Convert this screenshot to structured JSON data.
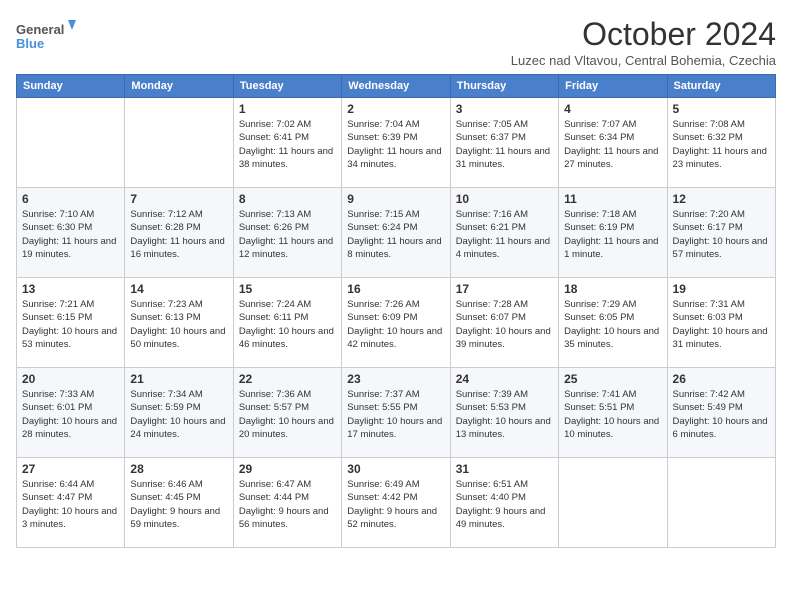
{
  "logo": {
    "text_general": "General",
    "text_blue": "Blue"
  },
  "header": {
    "month_year": "October 2024",
    "location": "Luzec nad Vltavou, Central Bohemia, Czechia"
  },
  "weekdays": [
    "Sunday",
    "Monday",
    "Tuesday",
    "Wednesday",
    "Thursday",
    "Friday",
    "Saturday"
  ],
  "weeks": [
    [
      {
        "day": "",
        "sunrise": "",
        "sunset": "",
        "daylight": ""
      },
      {
        "day": "",
        "sunrise": "",
        "sunset": "",
        "daylight": ""
      },
      {
        "day": "1",
        "sunrise": "Sunrise: 7:02 AM",
        "sunset": "Sunset: 6:41 PM",
        "daylight": "Daylight: 11 hours and 38 minutes."
      },
      {
        "day": "2",
        "sunrise": "Sunrise: 7:04 AM",
        "sunset": "Sunset: 6:39 PM",
        "daylight": "Daylight: 11 hours and 34 minutes."
      },
      {
        "day": "3",
        "sunrise": "Sunrise: 7:05 AM",
        "sunset": "Sunset: 6:37 PM",
        "daylight": "Daylight: 11 hours and 31 minutes."
      },
      {
        "day": "4",
        "sunrise": "Sunrise: 7:07 AM",
        "sunset": "Sunset: 6:34 PM",
        "daylight": "Daylight: 11 hours and 27 minutes."
      },
      {
        "day": "5",
        "sunrise": "Sunrise: 7:08 AM",
        "sunset": "Sunset: 6:32 PM",
        "daylight": "Daylight: 11 hours and 23 minutes."
      }
    ],
    [
      {
        "day": "6",
        "sunrise": "Sunrise: 7:10 AM",
        "sunset": "Sunset: 6:30 PM",
        "daylight": "Daylight: 11 hours and 19 minutes."
      },
      {
        "day": "7",
        "sunrise": "Sunrise: 7:12 AM",
        "sunset": "Sunset: 6:28 PM",
        "daylight": "Daylight: 11 hours and 16 minutes."
      },
      {
        "day": "8",
        "sunrise": "Sunrise: 7:13 AM",
        "sunset": "Sunset: 6:26 PM",
        "daylight": "Daylight: 11 hours and 12 minutes."
      },
      {
        "day": "9",
        "sunrise": "Sunrise: 7:15 AM",
        "sunset": "Sunset: 6:24 PM",
        "daylight": "Daylight: 11 hours and 8 minutes."
      },
      {
        "day": "10",
        "sunrise": "Sunrise: 7:16 AM",
        "sunset": "Sunset: 6:21 PM",
        "daylight": "Daylight: 11 hours and 4 minutes."
      },
      {
        "day": "11",
        "sunrise": "Sunrise: 7:18 AM",
        "sunset": "Sunset: 6:19 PM",
        "daylight": "Daylight: 11 hours and 1 minute."
      },
      {
        "day": "12",
        "sunrise": "Sunrise: 7:20 AM",
        "sunset": "Sunset: 6:17 PM",
        "daylight": "Daylight: 10 hours and 57 minutes."
      }
    ],
    [
      {
        "day": "13",
        "sunrise": "Sunrise: 7:21 AM",
        "sunset": "Sunset: 6:15 PM",
        "daylight": "Daylight: 10 hours and 53 minutes."
      },
      {
        "day": "14",
        "sunrise": "Sunrise: 7:23 AM",
        "sunset": "Sunset: 6:13 PM",
        "daylight": "Daylight: 10 hours and 50 minutes."
      },
      {
        "day": "15",
        "sunrise": "Sunrise: 7:24 AM",
        "sunset": "Sunset: 6:11 PM",
        "daylight": "Daylight: 10 hours and 46 minutes."
      },
      {
        "day": "16",
        "sunrise": "Sunrise: 7:26 AM",
        "sunset": "Sunset: 6:09 PM",
        "daylight": "Daylight: 10 hours and 42 minutes."
      },
      {
        "day": "17",
        "sunrise": "Sunrise: 7:28 AM",
        "sunset": "Sunset: 6:07 PM",
        "daylight": "Daylight: 10 hours and 39 minutes."
      },
      {
        "day": "18",
        "sunrise": "Sunrise: 7:29 AM",
        "sunset": "Sunset: 6:05 PM",
        "daylight": "Daylight: 10 hours and 35 minutes."
      },
      {
        "day": "19",
        "sunrise": "Sunrise: 7:31 AM",
        "sunset": "Sunset: 6:03 PM",
        "daylight": "Daylight: 10 hours and 31 minutes."
      }
    ],
    [
      {
        "day": "20",
        "sunrise": "Sunrise: 7:33 AM",
        "sunset": "Sunset: 6:01 PM",
        "daylight": "Daylight: 10 hours and 28 minutes."
      },
      {
        "day": "21",
        "sunrise": "Sunrise: 7:34 AM",
        "sunset": "Sunset: 5:59 PM",
        "daylight": "Daylight: 10 hours and 24 minutes."
      },
      {
        "day": "22",
        "sunrise": "Sunrise: 7:36 AM",
        "sunset": "Sunset: 5:57 PM",
        "daylight": "Daylight: 10 hours and 20 minutes."
      },
      {
        "day": "23",
        "sunrise": "Sunrise: 7:37 AM",
        "sunset": "Sunset: 5:55 PM",
        "daylight": "Daylight: 10 hours and 17 minutes."
      },
      {
        "day": "24",
        "sunrise": "Sunrise: 7:39 AM",
        "sunset": "Sunset: 5:53 PM",
        "daylight": "Daylight: 10 hours and 13 minutes."
      },
      {
        "day": "25",
        "sunrise": "Sunrise: 7:41 AM",
        "sunset": "Sunset: 5:51 PM",
        "daylight": "Daylight: 10 hours and 10 minutes."
      },
      {
        "day": "26",
        "sunrise": "Sunrise: 7:42 AM",
        "sunset": "Sunset: 5:49 PM",
        "daylight": "Daylight: 10 hours and 6 minutes."
      }
    ],
    [
      {
        "day": "27",
        "sunrise": "Sunrise: 6:44 AM",
        "sunset": "Sunset: 4:47 PM",
        "daylight": "Daylight: 10 hours and 3 minutes."
      },
      {
        "day": "28",
        "sunrise": "Sunrise: 6:46 AM",
        "sunset": "Sunset: 4:45 PM",
        "daylight": "Daylight: 9 hours and 59 minutes."
      },
      {
        "day": "29",
        "sunrise": "Sunrise: 6:47 AM",
        "sunset": "Sunset: 4:44 PM",
        "daylight": "Daylight: 9 hours and 56 minutes."
      },
      {
        "day": "30",
        "sunrise": "Sunrise: 6:49 AM",
        "sunset": "Sunset: 4:42 PM",
        "daylight": "Daylight: 9 hours and 52 minutes."
      },
      {
        "day": "31",
        "sunrise": "Sunrise: 6:51 AM",
        "sunset": "Sunset: 4:40 PM",
        "daylight": "Daylight: 9 hours and 49 minutes."
      },
      {
        "day": "",
        "sunrise": "",
        "sunset": "",
        "daylight": ""
      },
      {
        "day": "",
        "sunrise": "",
        "sunset": "",
        "daylight": ""
      }
    ]
  ]
}
